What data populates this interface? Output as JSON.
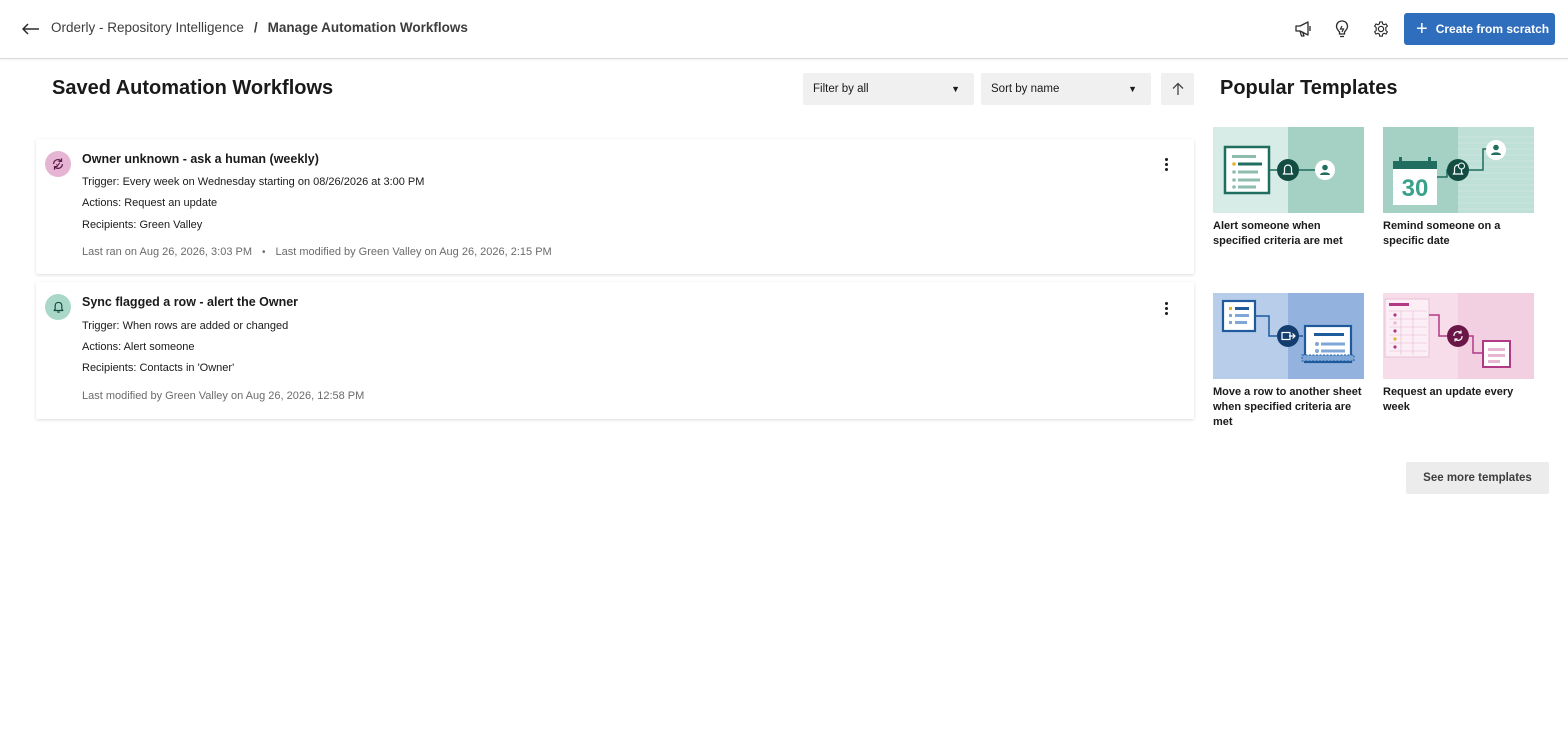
{
  "header": {
    "breadcrumb_parent": "Orderly - Repository Intelligence",
    "breadcrumb_separator": "/",
    "breadcrumb_current": "Manage Automation Workflows",
    "create_label": "Create from scratch",
    "icons": [
      "back-arrow-icon",
      "megaphone-icon",
      "lightbulb-icon",
      "gear-icon",
      "plus-icon"
    ]
  },
  "main": {
    "title": "Saved Automation Workflows",
    "filter_label": "Filter by all",
    "sort_label": "Sort by name"
  },
  "workflows": [
    {
      "icon": "recurring-update-icon",
      "icon_color": "#e6b5d3",
      "name": "Owner unknown - ask a human (weekly)",
      "trigger_label": "Trigger:",
      "trigger": "Every week on Wednesday starting on 08/26/2026 at 3:00 PM",
      "actions_label": "Actions:",
      "actions": "Request an update",
      "recipients_label": "Recipients:",
      "recipients": "Green Valley",
      "last_ran": "Last ran on Aug 26, 2026, 3:03 PM",
      "last_modified": "Last modified by Green Valley on Aug 26, 2026, 2:15 PM"
    },
    {
      "icon": "bell-icon",
      "icon_color": "#a9d7c8",
      "name": "Sync flagged a row - alert the Owner",
      "trigger_label": "Trigger:",
      "trigger": "When rows are added or changed",
      "actions_label": "Actions:",
      "actions": "Alert someone",
      "recipients_label": "Recipients:",
      "recipients": "Contacts in 'Owner'",
      "last_modified": "Last modified by Green Valley on Aug 26, 2026, 12:58 PM"
    }
  ],
  "templates": {
    "title": "Popular Templates",
    "items": [
      {
        "label": "Alert someone when specified criteria are met",
        "theme": "teal-alert"
      },
      {
        "label": "Remind someone on a specific date",
        "theme": "teal-calendar",
        "calendar_number": "30"
      },
      {
        "label": "Move a row to another sheet when specified criteria are met",
        "theme": "blue-move"
      },
      {
        "label": "Request an update every week",
        "theme": "pink-update"
      }
    ],
    "see_more_label": "See more templates"
  },
  "colors": {
    "primary": "#2f6dbd",
    "teal": "#1f6e5f",
    "blue": "#1e5a9c",
    "pink": "#b03a86"
  }
}
